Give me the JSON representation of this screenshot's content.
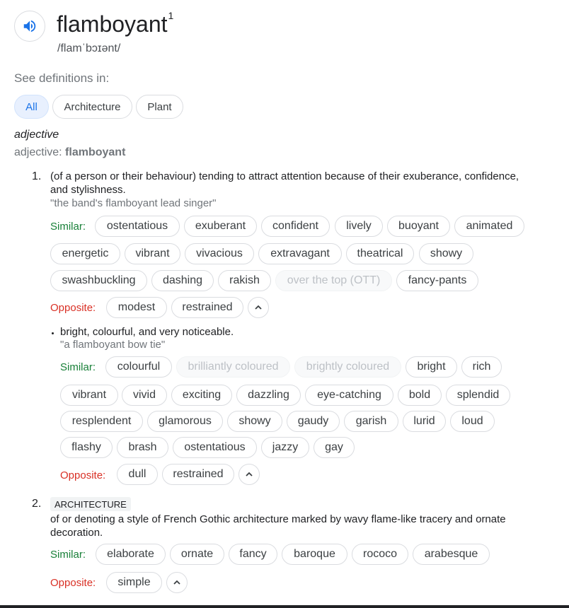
{
  "header": {
    "word": "flamboyant",
    "sup": "1",
    "pronunciation": "/flamˈbɔɪənt/"
  },
  "see_label": "See definitions in:",
  "tabs": [
    "All",
    "Architecture",
    "Plant"
  ],
  "pos": {
    "label": "adjective",
    "prefix": "adjective: ",
    "headword": "flamboyant"
  },
  "labels": {
    "similar": "Similar:",
    "opposite": "Opposite:"
  },
  "def1": {
    "number": "1.",
    "line1": "(of a person or their behaviour) tending to attract attention because of their exuberance, confidence,",
    "line2": "and stylishness.",
    "example": "\"the band's flamboyant lead singer\"",
    "similar_rows": [
      [
        "ostentatious",
        "exuberant",
        "confident",
        "lively",
        "buoyant",
        "animated"
      ],
      [
        "energetic",
        "vibrant",
        "vivacious",
        "extravagant",
        "theatrical",
        "showy"
      ],
      [
        "swashbuckling",
        "dashing",
        "rakish",
        "over the top (OTT)",
        "fancy-pants"
      ]
    ],
    "opposites": [
      "modest",
      "restrained"
    ]
  },
  "sub1": {
    "text": "bright, colourful, and very noticeable.",
    "example": "\"a flamboyant bow tie\"",
    "similar_rows": [
      [
        "colourful",
        "brilliantly coloured",
        "brightly coloured",
        "bright",
        "rich"
      ],
      [
        "vibrant",
        "vivid",
        "exciting",
        "dazzling",
        "eye-catching",
        "bold",
        "splendid"
      ],
      [
        "resplendent",
        "glamorous",
        "showy",
        "gaudy",
        "garish",
        "lurid",
        "loud"
      ],
      [
        "flashy",
        "brash",
        "ostentatious",
        "jazzy",
        "gay"
      ]
    ],
    "opposites": [
      "dull",
      "restrained"
    ]
  },
  "def2": {
    "number": "2.",
    "tag": "ARCHITECTURE",
    "line1": "of or denoting a style of French Gothic architecture marked by wavy flame-like tracery and ornate",
    "line2": "decoration.",
    "similar_rows": [
      [
        "elaborate",
        "ornate",
        "fancy",
        "baroque",
        "rococo",
        "arabesque"
      ]
    ],
    "opposites": [
      "simple"
    ]
  }
}
